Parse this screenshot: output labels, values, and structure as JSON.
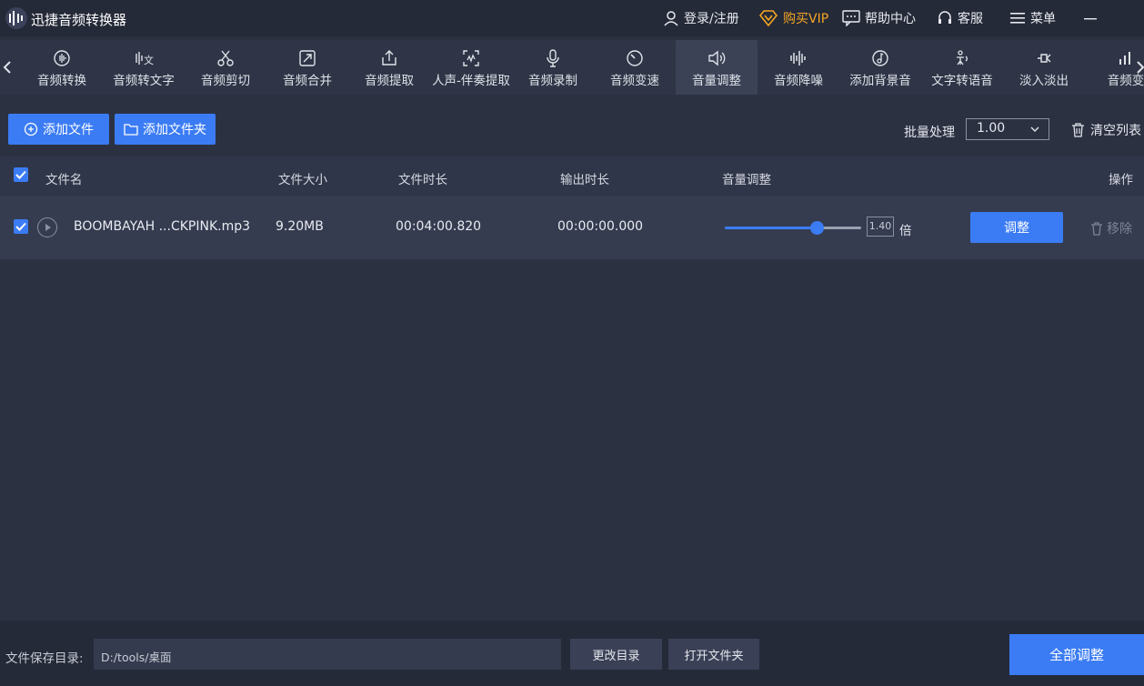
{
  "app": {
    "title": "迅捷音频转换器"
  },
  "titlebar": {
    "login": "登录/注册",
    "vip": "购买VIP",
    "help": "帮助中心",
    "service": "客服",
    "menu": "菜单"
  },
  "tools": [
    {
      "label": "音频转换",
      "icon": "audio-convert-icon"
    },
    {
      "label": "音频转文字",
      "icon": "speech-to-text-icon"
    },
    {
      "label": "音频剪切",
      "icon": "scissors-icon"
    },
    {
      "label": "音频合并",
      "icon": "merge-icon"
    },
    {
      "label": "音频提取",
      "icon": "extract-icon"
    },
    {
      "label": "人声-伴奏提取",
      "icon": "vocal-extract-icon"
    },
    {
      "label": "音频录制",
      "icon": "microphone-icon"
    },
    {
      "label": "音频变速",
      "icon": "speed-icon"
    },
    {
      "label": "音量调整",
      "icon": "volume-icon",
      "active": true
    },
    {
      "label": "音频降噪",
      "icon": "denoise-icon"
    },
    {
      "label": "添加背景音",
      "icon": "background-music-icon"
    },
    {
      "label": "文字转语音",
      "icon": "text-to-speech-icon"
    },
    {
      "label": "淡入淡出",
      "icon": "fade-icon"
    },
    {
      "label": "音频变",
      "icon": "audio-bars-icon"
    }
  ],
  "actions": {
    "add_file": "添加文件",
    "add_folder": "添加文件夹",
    "batch_label": "批量处理",
    "batch_value": "1.00",
    "clear_list": "清空列表"
  },
  "table": {
    "headers": {
      "name": "文件名",
      "size": "文件大小",
      "duration": "文件时长",
      "output_duration": "输出时长",
      "volume": "音量调整",
      "ops": "操作"
    },
    "rows": [
      {
        "name": "BOOMBAYAH ...CKPINK.mp3",
        "size": "9.20MB",
        "duration": "00:04:00.820",
        "output_duration": "00:00:00.000",
        "volume_level": 0.67,
        "volume_value": "1.40",
        "volume_unit": "倍",
        "adjust": "调整",
        "remove": "移除",
        "checked": true
      }
    ]
  },
  "footer": {
    "save_label": "文件保存目录:",
    "save_path": "D:/tools/桌面",
    "change_dir": "更改目录",
    "open_folder": "打开文件夹",
    "adjust_all": "全部调整"
  },
  "colors": {
    "accent": "#3b7cf4",
    "vip": "#f5a623",
    "background": "#2c3142"
  }
}
